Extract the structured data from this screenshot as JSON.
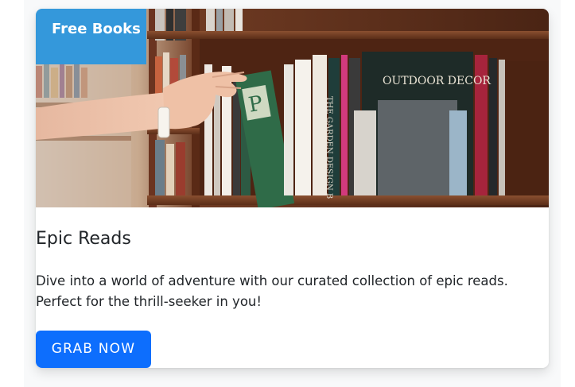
{
  "card": {
    "badge": "Free Books",
    "title": "Epic Reads",
    "description": "Dive into a world of adventure with our curated collection of epic reads. Perfect for the thrill-seeker in you!",
    "button_label": "GRAB NOW",
    "image_alt": "hand-reaching-for-book-on-library-shelf",
    "book_spine_texts": [
      "OUTDOOR DECOR",
      "THE GARDEN DESIGN B"
    ]
  },
  "colors": {
    "badge_bg": "#3498db",
    "button_bg": "#0d6efd",
    "text": "#212529",
    "page_bg": "#f8f9fa"
  }
}
